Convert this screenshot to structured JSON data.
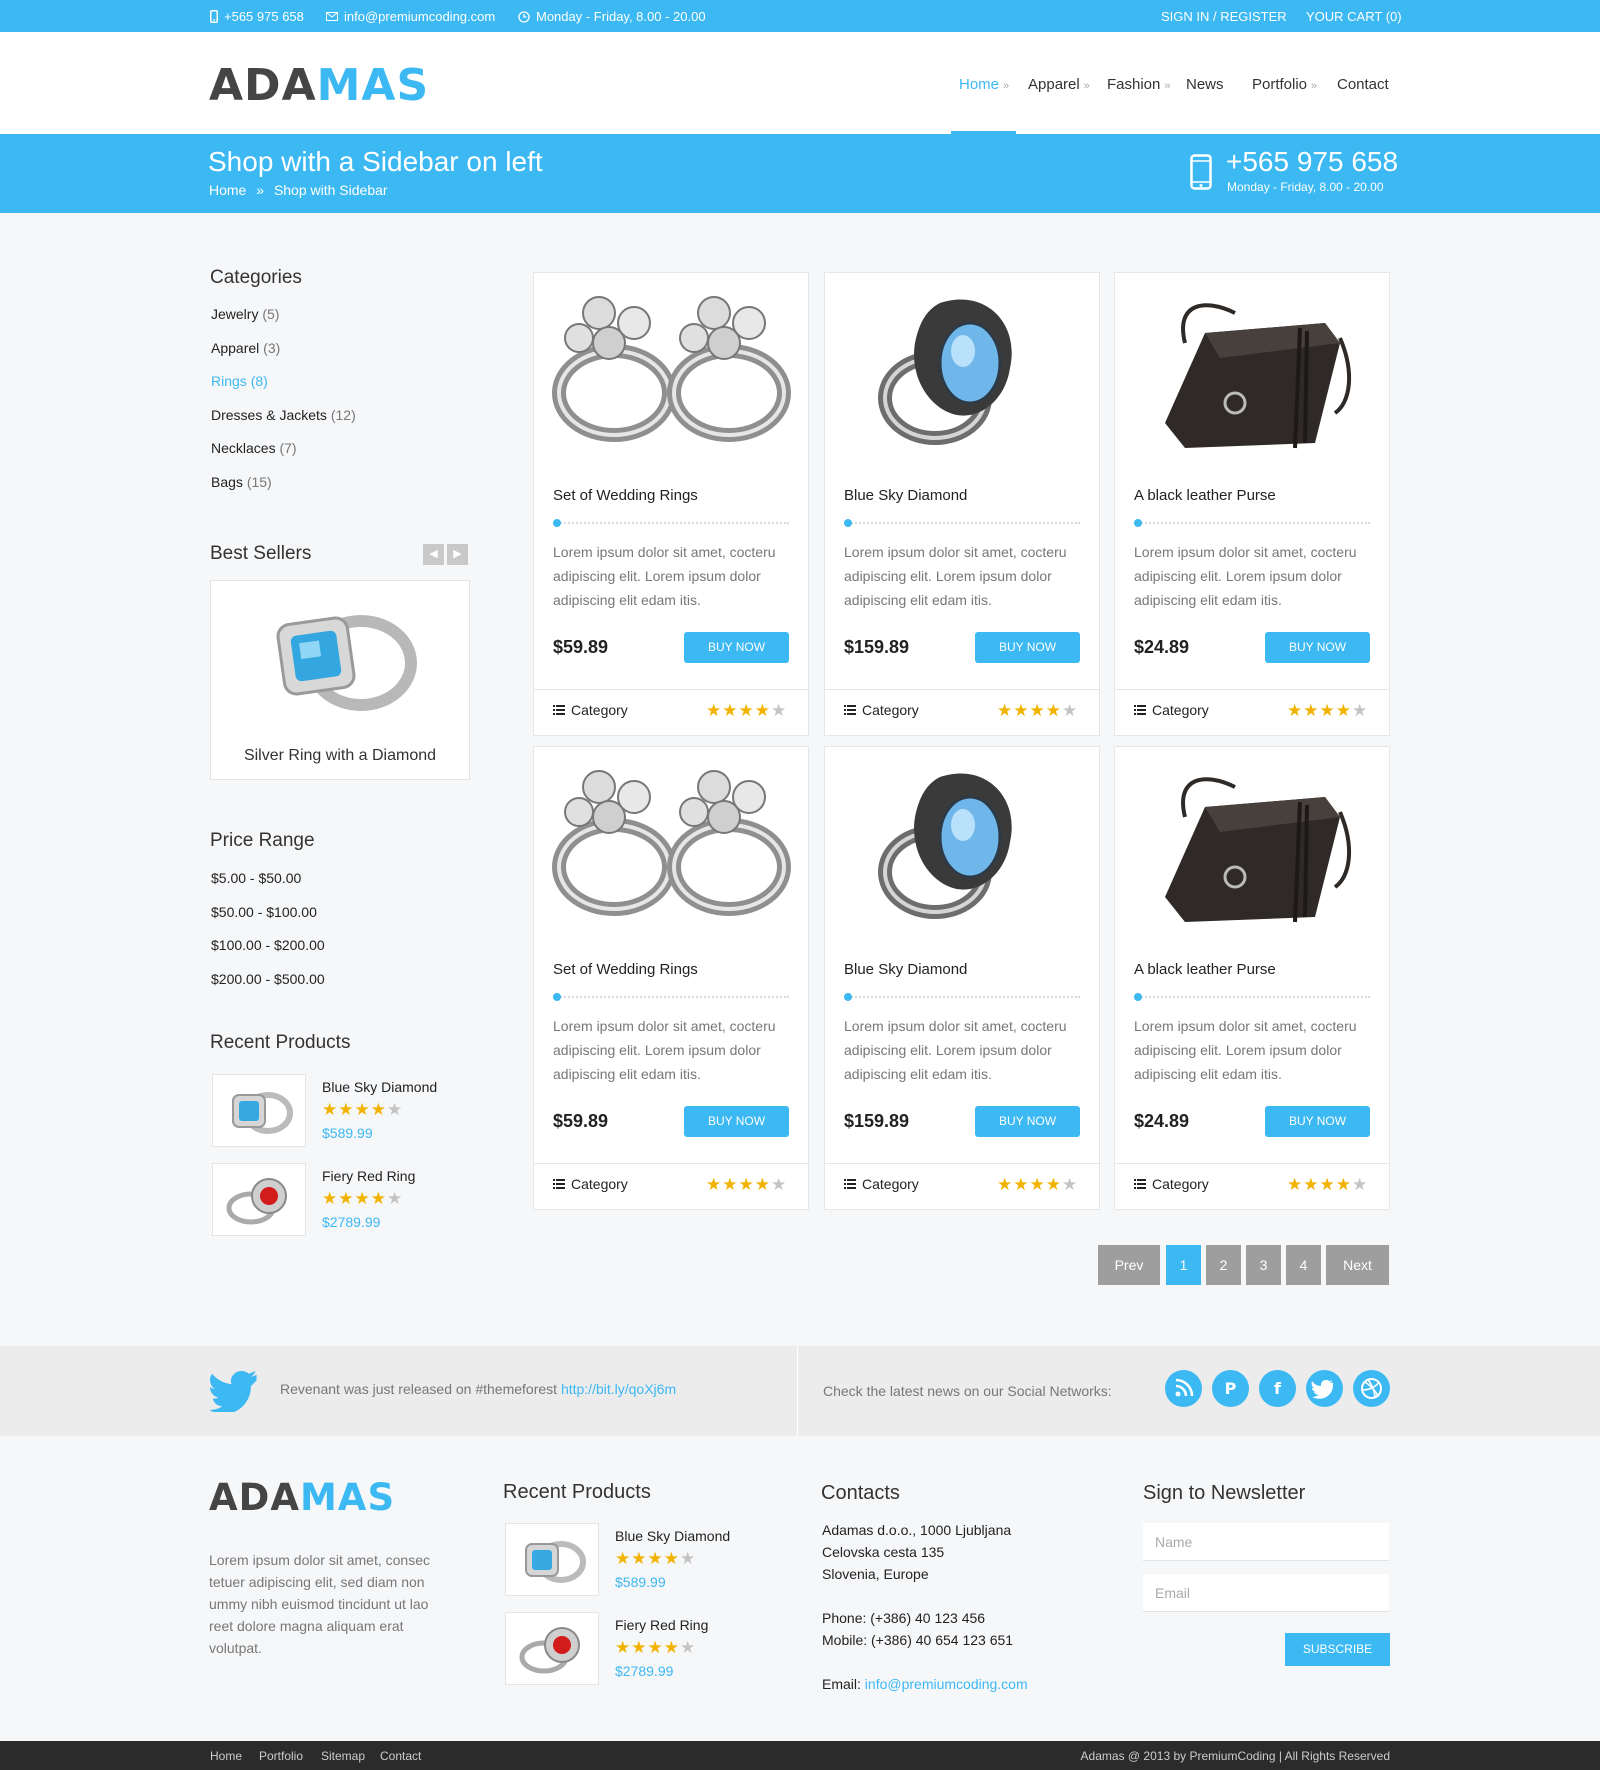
{
  "topbar": {
    "phone": "+565 975 658",
    "email": "info@premiumcoding.com",
    "hours": "Monday - Friday, 8.00 - 20.00",
    "signin": "SIGN IN / REGISTER",
    "cart": "YOUR CART (0)"
  },
  "logo": {
    "part1": "ADA",
    "part2": "MAS"
  },
  "nav": [
    {
      "label": "Home",
      "active": true,
      "has_sub": true
    },
    {
      "label": "Apparel",
      "has_sub": true
    },
    {
      "label": "Fashion",
      "has_sub": true
    },
    {
      "label": "News",
      "has_sub": false
    },
    {
      "label": "Portfolio",
      "has_sub": true
    },
    {
      "label": "Contact",
      "has_sub": false
    }
  ],
  "banner": {
    "title": "Shop with a Sidebar on left",
    "breadcrumb": [
      "Home",
      "Shop with Sidebar"
    ],
    "breadcrumb_sep": "»",
    "phone": "+565 975 658",
    "hours": "Monday - Friday, 8.00 - 20.00"
  },
  "sidebar": {
    "categories_title": "Categories",
    "categories": [
      {
        "name": "Jewelry",
        "count": "(5)"
      },
      {
        "name": "Apparel",
        "count": "(3)"
      },
      {
        "name": "Rings",
        "count": "(8)",
        "active": true
      },
      {
        "name": "Dresses & Jackets",
        "count": "(12)"
      },
      {
        "name": "Necklaces",
        "count": "(7)"
      },
      {
        "name": "Bags",
        "count": "(15)"
      }
    ],
    "bestsellers_title": "Best Sellers",
    "bestseller": {
      "name": "Silver Ring with a Diamond"
    },
    "price_title": "Price Range",
    "prices": [
      "$5.00 - $50.00",
      "$50.00 - $100.00",
      "$100.00 - $200.00",
      "$200.00 - $500.00"
    ],
    "recent_title": "Recent Products",
    "recent": [
      {
        "name": "Blue Sky Diamond",
        "price": "$589.99",
        "rating": 4
      },
      {
        "name": "Fiery Red Ring",
        "price": "$2789.99",
        "rating": 4
      }
    ]
  },
  "products": [
    {
      "name": "Set of Wedding Rings",
      "desc": "Lorem ipsum dolor sit amet, cocteru adipiscing elit. Lorem ipsum dolor adipiscing elit edam itis.",
      "price": "$59.89",
      "buy": "BUY NOW",
      "category": "Category",
      "rating": 4,
      "image": "rings-image"
    },
    {
      "name": "Blue Sky Diamond",
      "desc": "Lorem ipsum dolor sit amet, cocteru adipiscing elit. Lorem ipsum dolor adipiscing elit edam itis.",
      "price": "$159.89",
      "buy": "BUY NOW",
      "category": "Category",
      "rating": 4,
      "image": "blue-ring-image"
    },
    {
      "name": "A black leather Purse",
      "desc": "Lorem ipsum dolor sit amet, cocteru adipiscing elit. Lorem ipsum dolor adipiscing elit edam itis.",
      "price": "$24.89",
      "buy": "BUY NOW",
      "category": "Category",
      "rating": 4,
      "image": "purse-image"
    },
    {
      "name": "Set of Wedding Rings",
      "desc": "Lorem ipsum dolor sit amet, cocteru adipiscing elit. Lorem ipsum dolor adipiscing elit edam itis.",
      "price": "$59.89",
      "buy": "BUY NOW",
      "category": "Category",
      "rating": 4,
      "image": "rings-image"
    },
    {
      "name": "Blue Sky Diamond",
      "desc": "Lorem ipsum dolor sit amet, cocteru adipiscing elit. Lorem ipsum dolor adipiscing elit edam itis.",
      "price": "$159.89",
      "buy": "BUY NOW",
      "category": "Category",
      "rating": 4,
      "image": "blue-ring-image"
    },
    {
      "name": "A black leather Purse",
      "desc": "Lorem ipsum dolor sit amet, cocteru adipiscing elit. Lorem ipsum dolor adipiscing elit edam itis.",
      "price": "$24.89",
      "buy": "BUY NOW",
      "category": "Category",
      "rating": 4,
      "image": "purse-image"
    }
  ],
  "pagination": {
    "prev": "Prev",
    "pages": [
      "1",
      "2",
      "3",
      "4"
    ],
    "current": "1",
    "next": "Next"
  },
  "social": {
    "tweet_text": "Revenant was just released on #themeforest",
    "tweet_link": "http://bit.ly/qoXj6m",
    "check_text": "Check the latest news on our Social Networks:",
    "networks": [
      "rss-icon",
      "pinterest-icon",
      "facebook-icon",
      "twitter-icon",
      "dribbble-icon"
    ]
  },
  "footer": {
    "about": "Lorem ipsum dolor sit amet, consec tetuer adipiscing elit, sed diam non ummy nibh euismod tincidunt ut lao reet dolore magna aliquam erat volutpat.",
    "recent_title": "Recent Products",
    "recent": [
      {
        "name": "Blue Sky Diamond",
        "price": "$589.99",
        "rating": 4
      },
      {
        "name": "Fiery Red Ring",
        "price": "$2789.99",
        "rating": 4
      }
    ],
    "contacts_title": "Contacts",
    "address": [
      "Adamas d.o.o., 1000 Ljubljana",
      "Celovska cesta 135",
      "Slovenia, Europe"
    ],
    "phone": "Phone: (+386) 40 123 456",
    "mobile": "Mobile: (+386) 40 654 123 651",
    "email_label": "Email:",
    "email": "info@premiumcoding.com",
    "newsletter_title": "Sign to Newsletter",
    "name_placeholder": "Name",
    "email_placeholder": "Email",
    "subscribe": "SUBSCRIBE",
    "links": [
      "Home",
      "Portfolio",
      "Sitemap",
      "Contact"
    ],
    "copyright": "Adamas @ 2013 by PremiumCoding | All Rights Reserved"
  },
  "colors": {
    "accent": "#3cb8f3",
    "star": "#f2b200",
    "pager": "#9e9e9e",
    "bottom": "#2b2b2b"
  }
}
